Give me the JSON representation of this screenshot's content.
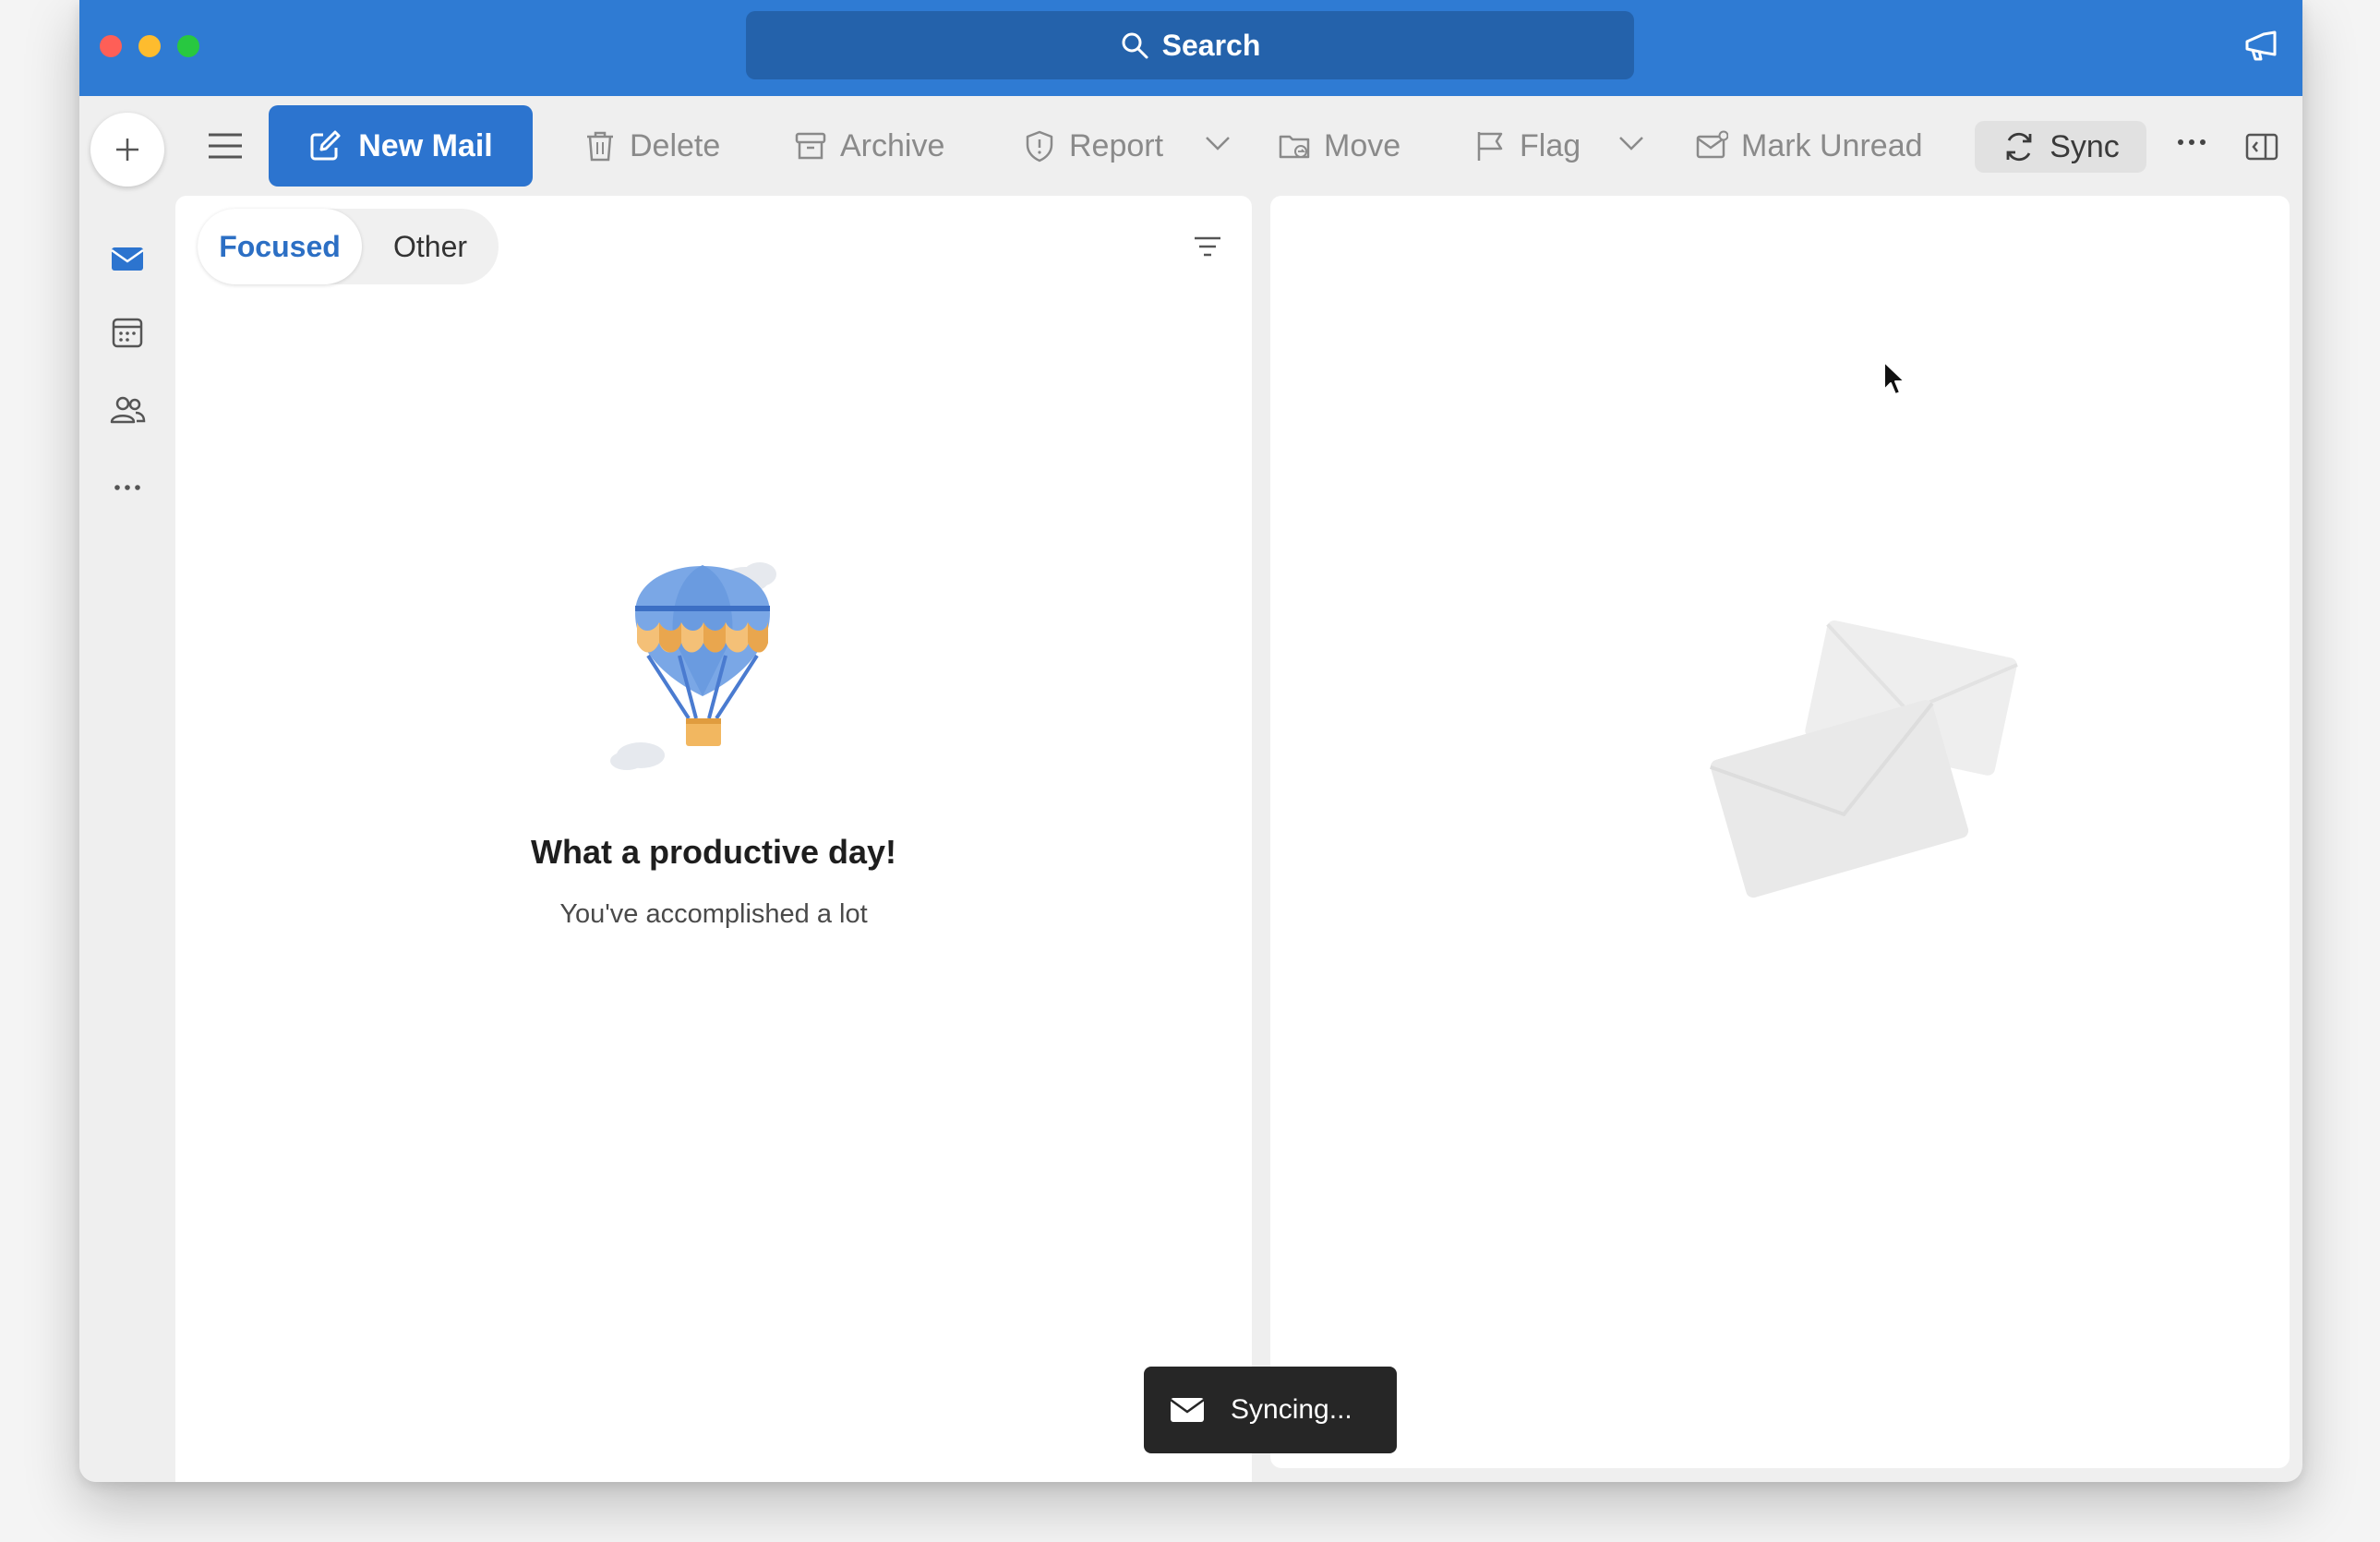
{
  "search": {
    "label": "Search"
  },
  "toolbar": {
    "new_mail": "New Mail",
    "delete": "Delete",
    "archive": "Archive",
    "report": "Report",
    "move": "Move",
    "flag": "Flag",
    "mark_unread": "Mark Unread",
    "sync": "Sync"
  },
  "nav": {
    "items": [
      {
        "icon": "mail-icon",
        "active": true
      },
      {
        "icon": "calendar-icon",
        "active": false
      },
      {
        "icon": "people-icon",
        "active": false
      },
      {
        "icon": "more-apps-icon",
        "active": false
      }
    ]
  },
  "tabs": {
    "focused": "Focused",
    "other": "Other"
  },
  "empty_state": {
    "title": "What a productive day!",
    "subtitle": "You've accomplished a lot"
  },
  "toast": {
    "text": "Syncing..."
  },
  "colors": {
    "brand": "#2f7bd3",
    "new_mail_bg": "#2c74cf",
    "focused_tab": "#2c6fc4",
    "toast_bg": "#262626"
  }
}
